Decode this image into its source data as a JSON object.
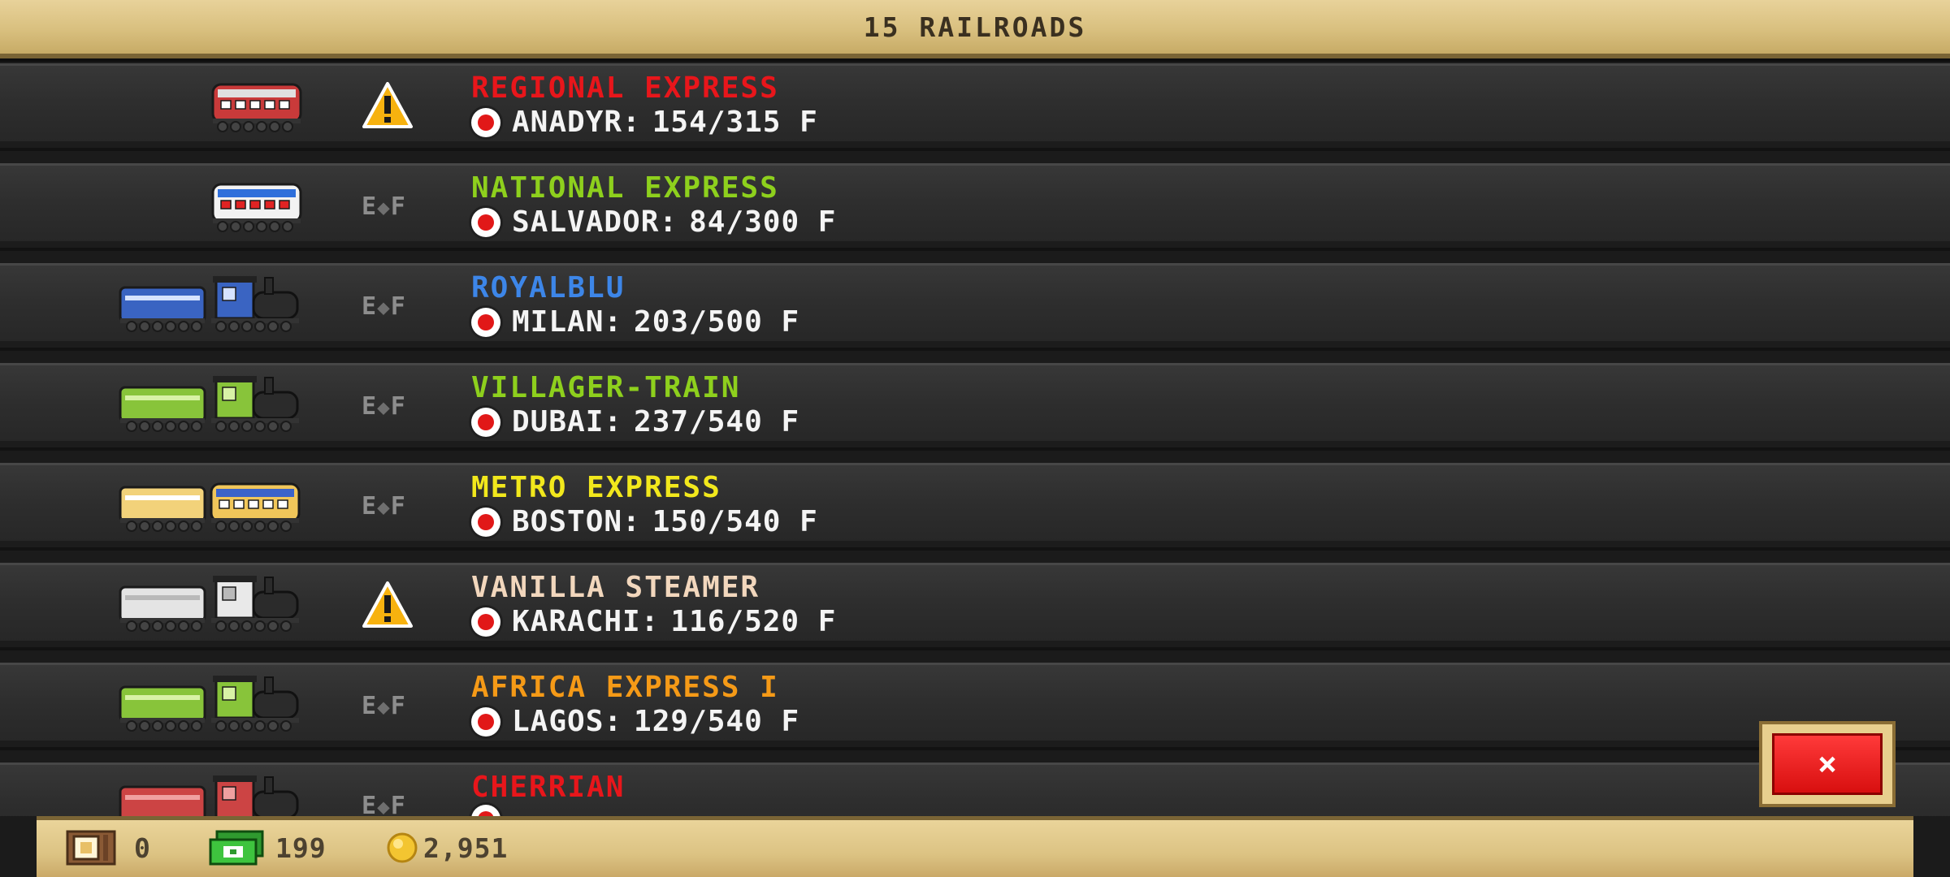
{
  "header": {
    "title": "15 RAILROADS"
  },
  "routes": [
    {
      "name": "REGIONAL EXPRESS",
      "color": "#e8161b",
      "city": "ANADYR:",
      "capacity": "154/315 F",
      "status": "warning",
      "train": "red-diesel"
    },
    {
      "name": "NATIONAL EXPRESS",
      "color": "#8ed01d",
      "city": "SALVADOR:",
      "capacity": "84/300 F",
      "status": "ef",
      "train": "white-diesel"
    },
    {
      "name": "ROYALBLU",
      "color": "#3d86e8",
      "city": "MILAN:",
      "capacity": "203/500 F",
      "status": "ef",
      "train": "blue-steam"
    },
    {
      "name": "VILLAGER-TRAIN",
      "color": "#8ed01d",
      "city": "DUBAI:",
      "capacity": "237/540 F",
      "status": "ef",
      "train": "green-steam"
    },
    {
      "name": "METRO EXPRESS",
      "color": "#f2e81c",
      "city": "BOSTON:",
      "capacity": "150/540 F",
      "status": "ef",
      "train": "yellow-diesel"
    },
    {
      "name": "VANILLA STEAMER",
      "color": "#f2d7bd",
      "city": "KARACHI:",
      "capacity": "116/520 F",
      "status": "warning",
      "train": "white-steam"
    },
    {
      "name": "AFRICA EXPRESS I",
      "color": "#f59a17",
      "city": "LAGOS:",
      "capacity": "129/540 F",
      "status": "ef",
      "train": "green-steam"
    },
    {
      "name": "CHERRIAN",
      "color": "#e8161b",
      "city": "",
      "capacity": "",
      "status": "ef",
      "train": "red-steam"
    }
  ],
  "status_labels": {
    "ef_left": "E",
    "ef_right": "F"
  },
  "close_button": {
    "label": "×"
  },
  "footer": {
    "crates": "0",
    "cash": "199",
    "coins": "2,951"
  },
  "colors": {
    "warning": "#f7b20f",
    "station_dot": "#e11818",
    "close_button": "#e8161b",
    "panel": "#dcc383"
  },
  "icons": {
    "warning": "warning-icon",
    "ef": "fuel-gauge-icon",
    "station": "station-dot-icon",
    "crate": "crate-icon",
    "cash": "cash-icon",
    "coin": "coin-icon",
    "close": "close-icon"
  }
}
